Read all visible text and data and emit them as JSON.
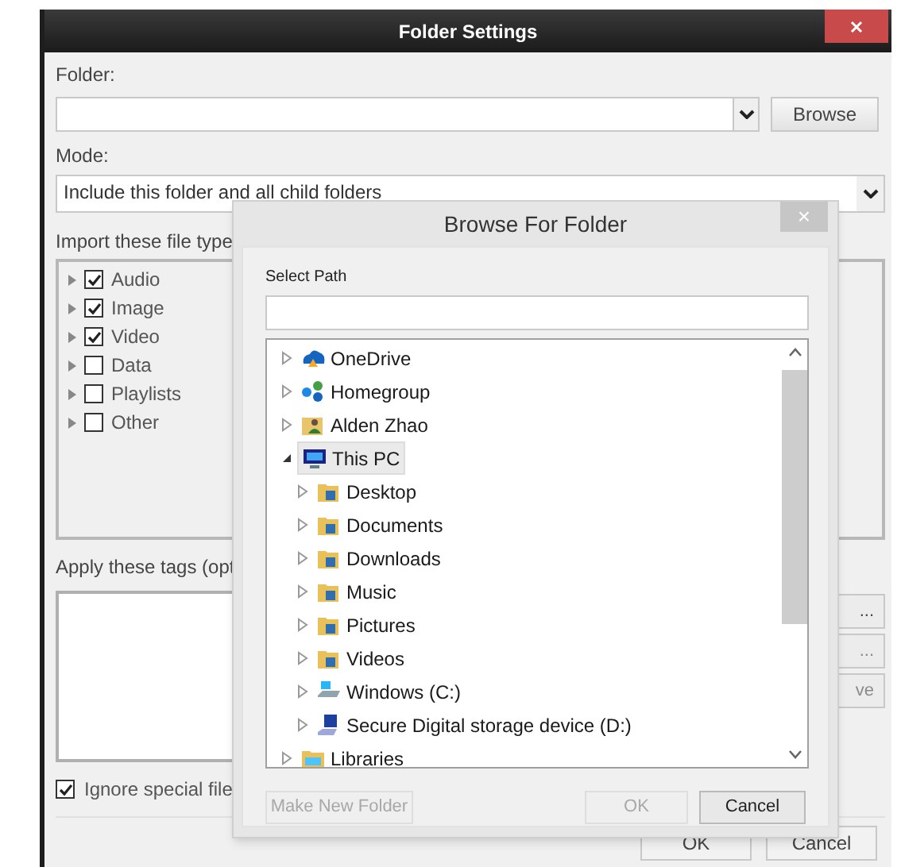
{
  "window": {
    "title": "Folder Settings"
  },
  "folder": {
    "label": "Folder:",
    "button": "Browse"
  },
  "mode": {
    "label": "Mode:",
    "value": "Include this folder and all child folders"
  },
  "file_types": {
    "label": "Import these file type",
    "items": [
      {
        "name": "Audio",
        "checked": true
      },
      {
        "name": "Image",
        "checked": true
      },
      {
        "name": "Video",
        "checked": true
      },
      {
        "name": "Data",
        "checked": false
      },
      {
        "name": "Playlists",
        "checked": false
      },
      {
        "name": "Other",
        "checked": false
      }
    ]
  },
  "tags": {
    "label": "Apply these tags (opt",
    "buttons": [
      {
        "label": "...",
        "disabled": false
      },
      {
        "label": "...",
        "disabled": true
      },
      {
        "label": "ve",
        "disabled": true
      }
    ]
  },
  "ignore_special": {
    "label": "Ignore special file",
    "checked": true
  },
  "buttons": [
    {
      "label": "OK"
    },
    {
      "label": "Cancel"
    }
  ],
  "browse_dialog": {
    "title": "Browse For Folder",
    "close": "×",
    "path_label": "Select Path",
    "tree": [
      {
        "name": "OneDrive",
        "kind": "cloud",
        "expanded": false,
        "selected": false
      },
      {
        "name": "Homegroup",
        "kind": "network",
        "expanded": false,
        "selected": false
      },
      {
        "name": "Alden Zhao",
        "kind": "user",
        "expanded": false,
        "selected": false
      },
      {
        "name": "This PC",
        "kind": "computer",
        "expanded": true,
        "selected": true,
        "children": [
          {
            "name": "Desktop",
            "kind": "folder",
            "expanded": false,
            "selected": false
          },
          {
            "name": "Documents",
            "kind": "folder",
            "expanded": false,
            "selected": false
          },
          {
            "name": "Downloads",
            "kind": "folder",
            "expanded": false,
            "selected": false
          },
          {
            "name": "Music",
            "kind": "folder",
            "expanded": false,
            "selected": false
          },
          {
            "name": "Pictures",
            "kind": "folder",
            "expanded": false,
            "selected": false
          },
          {
            "name": "Videos",
            "kind": "folder",
            "expanded": false,
            "selected": false
          },
          {
            "name": "Windows (C:)",
            "kind": "drive",
            "expanded": false,
            "selected": false
          },
          {
            "name": "Secure Digital storage device (D:)",
            "kind": "removable",
            "expanded": false,
            "selected": false
          }
        ]
      },
      {
        "name": "Libraries",
        "kind": "library",
        "expanded": false,
        "selected": false
      }
    ],
    "buttons": [
      {
        "label": "Make New Folder",
        "disabled": true
      },
      {
        "label": "OK",
        "disabled": true
      },
      {
        "label": "Cancel",
        "disabled": false
      }
    ]
  }
}
